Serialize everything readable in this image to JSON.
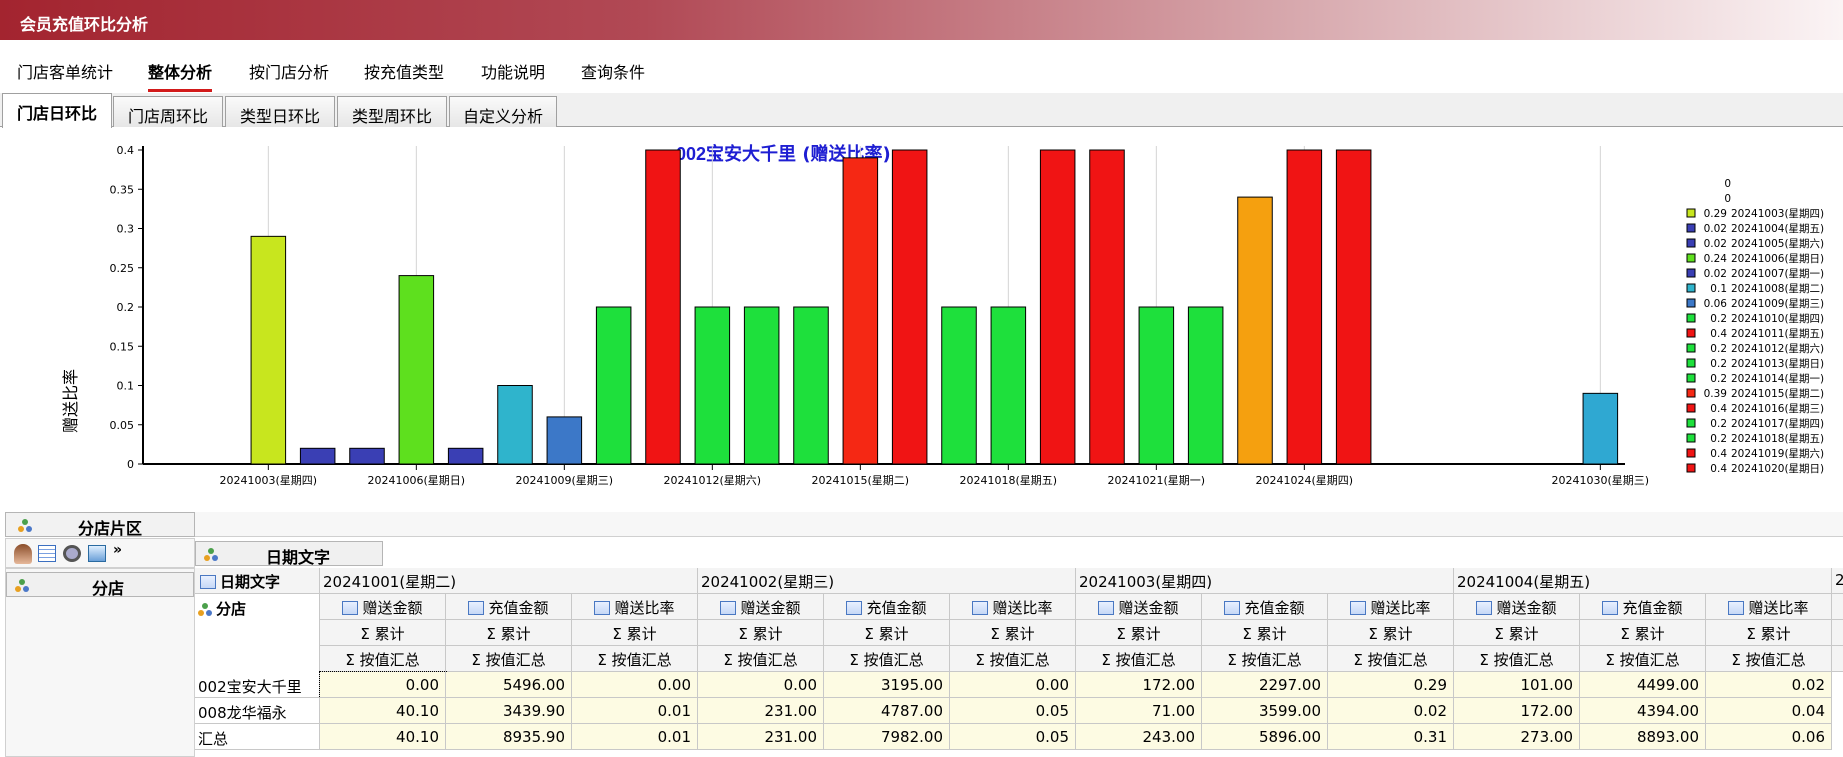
{
  "window": {
    "title": "会员充值环比分析"
  },
  "menu": [
    {
      "label": "门店客单统计",
      "active": false
    },
    {
      "label": "整体分析",
      "active": true
    },
    {
      "label": "按门店分析",
      "active": false
    },
    {
      "label": "按充值类型",
      "active": false
    },
    {
      "label": "功能说明",
      "active": false
    },
    {
      "label": "查询条件",
      "active": false
    }
  ],
  "tabs": [
    {
      "label": "门店日环比",
      "active": true
    },
    {
      "label": "门店周环比",
      "active": false
    },
    {
      "label": "类型日环比",
      "active": false
    },
    {
      "label": "类型周环比",
      "active": false
    },
    {
      "label": "自定义分析",
      "active": false
    }
  ],
  "chart_data": {
    "type": "bar",
    "title_prefix": "002",
    "title_text": "宝安大千里 (赠送比率)",
    "ylabel": "赠送比率",
    "ylim": [
      0,
      0.4
    ],
    "yticks": [
      "0",
      "0.05",
      "0.1",
      "0.15",
      "0.2",
      "0.25",
      "0.3",
      "0.35",
      "0.4"
    ],
    "xticks": [
      "20241003(星期四)",
      "20241006(星期日)",
      "20241009(星期三)",
      "20241012(星期六)",
      "20241015(星期二)",
      "20241018(星期五)",
      "20241021(星期一)",
      "20241024(星期四)",
      "20241030(星期三)"
    ],
    "series": [
      {
        "date": "20241001",
        "value": 0,
        "color": "#c8e61e"
      },
      {
        "date": "20241002",
        "value": 0,
        "color": "#c8e61e"
      },
      {
        "date": "20241003",
        "value": 0.29,
        "color": "#c8e61e"
      },
      {
        "date": "20241004",
        "value": 0.02,
        "color": "#3a3fb4"
      },
      {
        "date": "20241005",
        "value": 0.02,
        "color": "#3a3fb4"
      },
      {
        "date": "20241006",
        "value": 0.24,
        "color": "#5ee01e"
      },
      {
        "date": "20241007",
        "value": 0.02,
        "color": "#3a3fb4"
      },
      {
        "date": "20241008",
        "value": 0.1,
        "color": "#2fb4cc"
      },
      {
        "date": "20241009",
        "value": 0.06,
        "color": "#3c78c8"
      },
      {
        "date": "20241010",
        "value": 0.2,
        "color": "#1ee03c"
      },
      {
        "date": "20241011",
        "value": 0.4,
        "color": "#f01414"
      },
      {
        "date": "20241012",
        "value": 0.2,
        "color": "#1ee03c"
      },
      {
        "date": "20241013",
        "value": 0.2,
        "color": "#1ee03c"
      },
      {
        "date": "20241014",
        "value": 0.2,
        "color": "#1ee03c"
      },
      {
        "date": "20241015",
        "value": 0.39,
        "color": "#f52814"
      },
      {
        "date": "20241016",
        "value": 0.4,
        "color": "#f01414"
      },
      {
        "date": "20241017",
        "value": 0.2,
        "color": "#1ee03c"
      },
      {
        "date": "20241018",
        "value": 0.2,
        "color": "#1ee03c"
      },
      {
        "date": "20241019",
        "value": 0.4,
        "color": "#f01414"
      },
      {
        "date": "20241020",
        "value": 0.4,
        "color": "#f01414"
      },
      {
        "date": "20241021",
        "value": 0.2,
        "color": "#1ee03c"
      },
      {
        "date": "20241022",
        "value": 0.2,
        "color": "#1ee03c"
      },
      {
        "date": "20241023",
        "value": 0.34,
        "color": "#f5a00f"
      },
      {
        "date": "20241024",
        "value": 0.4,
        "color": "#f01414"
      },
      {
        "date": "20241025",
        "value": 0.4,
        "color": "#f01414"
      },
      {
        "date": "20241026",
        "value": 0,
        "color": "#1ee03c"
      },
      {
        "date": "20241027",
        "value": 0,
        "color": "#1ee03c"
      },
      {
        "date": "20241028",
        "value": 0,
        "color": "#1ee03c"
      },
      {
        "date": "20241029",
        "value": 0,
        "color": "#1ee03c"
      },
      {
        "date": "20241030",
        "value": 0.09,
        "color": "#2fa8d2"
      }
    ],
    "legend": [
      {
        "value": "0",
        "label": "",
        "color": ""
      },
      {
        "value": "0",
        "label": "",
        "color": ""
      },
      {
        "value": "0.29",
        "label": "20241003(星期四)",
        "color": "#c8e61e"
      },
      {
        "value": "0.02",
        "label": "20241004(星期五)",
        "color": "#3a3fb4"
      },
      {
        "value": "0.02",
        "label": "20241005(星期六)",
        "color": "#3a3fb4"
      },
      {
        "value": "0.24",
        "label": "20241006(星期日)",
        "color": "#5ee01e"
      },
      {
        "value": "0.02",
        "label": "20241007(星期一)",
        "color": "#3a3fb4"
      },
      {
        "value": "0.1",
        "label": "20241008(星期二)",
        "color": "#2fb4cc"
      },
      {
        "value": "0.06",
        "label": "20241009(星期三)",
        "color": "#3c78c8"
      },
      {
        "value": "0.2",
        "label": "20241010(星期四)",
        "color": "#1ee03c"
      },
      {
        "value": "0.4",
        "label": "20241011(星期五)",
        "color": "#f01414"
      },
      {
        "value": "0.2",
        "label": "20241012(星期六)",
        "color": "#1ee03c"
      },
      {
        "value": "0.2",
        "label": "20241013(星期日)",
        "color": "#1ee03c"
      },
      {
        "value": "0.2",
        "label": "20241014(星期一)",
        "color": "#1ee03c"
      },
      {
        "value": "0.39",
        "label": "20241015(星期二)",
        "color": "#f52814"
      },
      {
        "value": "0.4",
        "label": "20241016(星期三)",
        "color": "#f01414"
      },
      {
        "value": "0.2",
        "label": "20241017(星期四)",
        "color": "#1ee03c"
      },
      {
        "value": "0.2",
        "label": "20241018(星期五)",
        "color": "#1ee03c"
      },
      {
        "value": "0.4",
        "label": "20241019(星期六)",
        "color": "#f01414"
      },
      {
        "value": "0.4",
        "label": "20241020(星期日)",
        "color": "#f01414"
      }
    ]
  },
  "pivot": {
    "filter_area_label": "分店片区",
    "left_field_label": "分店",
    "column_field_label": "日期文字",
    "column_header_label": "日期文字",
    "row_header_label": "分店",
    "date_columns": [
      "20241001(星期二)",
      "20241002(星期三)",
      "20241003(星期四)",
      "20241004(星期五)",
      "2"
    ],
    "measures": [
      "赠送金额",
      "充值金额",
      "赠送比率"
    ],
    "sum_label": "Σ 累计",
    "agg_label": "Σ 按值汇总",
    "rows": [
      {
        "label": "002宝安大千里",
        "values": [
          "0.00",
          "5496.00",
          "0.00",
          "0.00",
          "3195.00",
          "0.00",
          "172.00",
          "2297.00",
          "0.29",
          "101.00",
          "4499.00",
          "0.02"
        ]
      },
      {
        "label": "008龙华福永",
        "values": [
          "40.10",
          "3439.90",
          "0.01",
          "231.00",
          "4787.00",
          "0.05",
          "71.00",
          "3599.00",
          "0.02",
          "172.00",
          "4394.00",
          "0.04"
        ]
      },
      {
        "label": "汇总",
        "values": [
          "40.10",
          "8935.90",
          "0.01",
          "231.00",
          "7982.00",
          "0.05",
          "243.00",
          "5896.00",
          "0.31",
          "273.00",
          "8893.00",
          "0.06"
        ]
      }
    ]
  },
  "toolbar_icons": [
    "user-icon",
    "grid-icon",
    "settings-icon",
    "export-icon",
    "more-icon"
  ]
}
